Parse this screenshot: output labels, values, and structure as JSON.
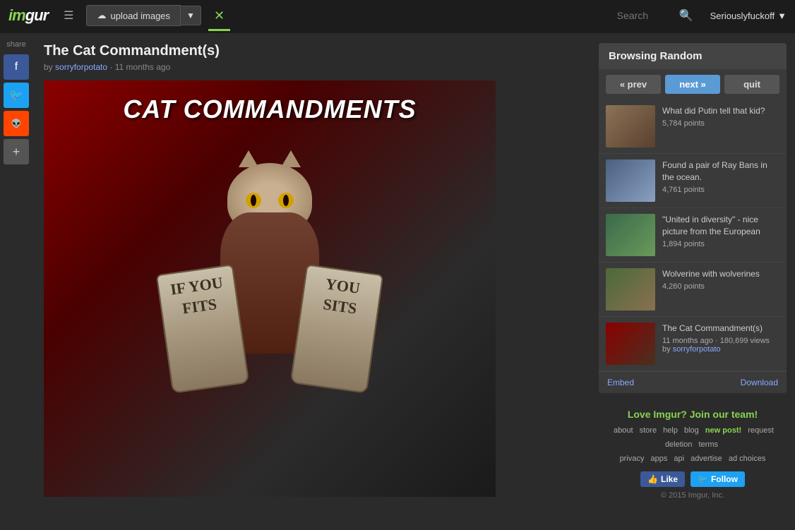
{
  "header": {
    "logo": "imgur",
    "upload_label": "upload images",
    "search_placeholder": "Search",
    "user_label": "Seriouslyfuckoff",
    "shuffle_icon": "✕"
  },
  "share": {
    "label": "share",
    "buttons": [
      {
        "name": "facebook",
        "icon": "f"
      },
      {
        "name": "twitter",
        "icon": "🐦"
      },
      {
        "name": "reddit",
        "icon": "👽"
      },
      {
        "name": "more",
        "icon": "+"
      }
    ]
  },
  "post": {
    "title": "The Cat Commandment(s)",
    "by_label": "by",
    "author": "sorryforpotato",
    "time_ago": "11 months ago",
    "meme_title": "CAT COMMANDMENTS",
    "tablet_left": "IF YOU FITS",
    "tablet_right": "YOU SITS"
  },
  "browsing": {
    "header": "Browsing Random",
    "prev_label": "« prev",
    "next_label": "next »",
    "quit_label": "quit",
    "items": [
      {
        "title": "What did Putin tell that kid?",
        "points": "5,784 points",
        "thumb_class": "thumb-putin"
      },
      {
        "title": "Found a pair of Ray Bans in the ocean.",
        "points": "4,761 points",
        "thumb_class": "thumb-raybans"
      },
      {
        "title": "\"United in diversity\" - nice picture from the European",
        "points": "1,894 points",
        "thumb_class": "thumb-europe"
      },
      {
        "title": "Wolverine with wolverines",
        "points": "4,260 points",
        "thumb_class": "thumb-wolverine"
      },
      {
        "title": "The Cat Commandment(s)",
        "meta": "11 months ago · 180,699 views",
        "by_label": "by",
        "author": "sorryforpotato",
        "thumb_class": "thumb-catcmd",
        "is_current": true
      }
    ],
    "embed_label": "Embed",
    "download_label": "Download"
  },
  "footer": {
    "love_text": "Love Imgur? Join our team!",
    "links": [
      {
        "label": "about",
        "href": "#"
      },
      {
        "label": "store",
        "href": "#"
      },
      {
        "label": "help",
        "href": "#"
      },
      {
        "label": "blog",
        "href": "#"
      },
      {
        "label": "new post!",
        "href": "#",
        "class": "new-post"
      },
      {
        "label": "request deletion",
        "href": "#"
      },
      {
        "label": "terms",
        "href": "#"
      },
      {
        "label": "privacy",
        "href": "#"
      },
      {
        "label": "apps",
        "href": "#"
      },
      {
        "label": "api",
        "href": "#"
      },
      {
        "label": "advertise",
        "href": "#"
      },
      {
        "label": "ad choices",
        "href": "#"
      }
    ],
    "facebook_label": "Like",
    "twitter_label": "Follow",
    "copyright": "© 2015 Imgur, Inc."
  }
}
